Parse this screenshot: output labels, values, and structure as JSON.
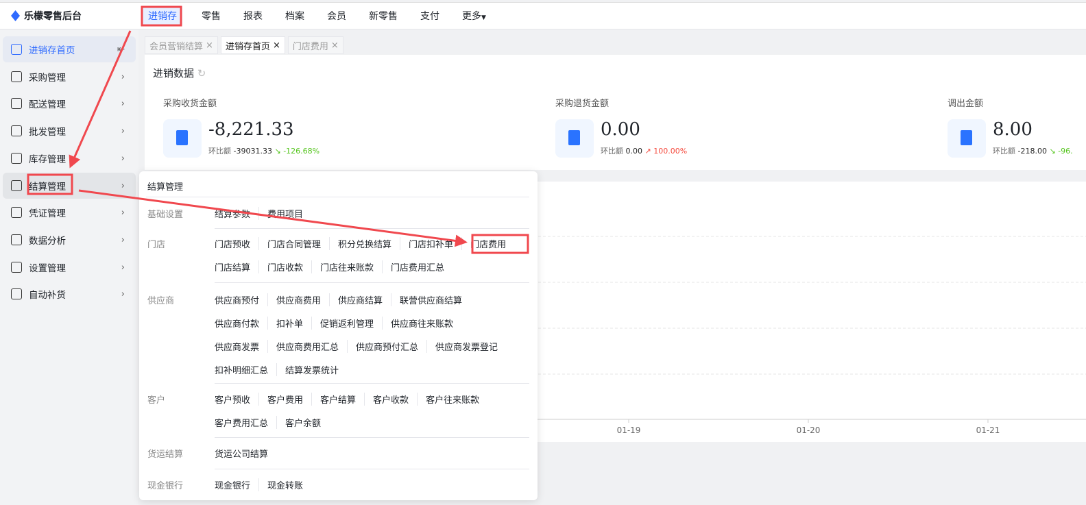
{
  "app": {
    "title": "乐檬零售后台"
  },
  "topnav": [
    "进销存",
    "零售",
    "报表",
    "档案",
    "会员",
    "新零售",
    "支付",
    "更多"
  ],
  "sidebar": [
    {
      "label": "进销存首页"
    },
    {
      "label": "采购管理"
    },
    {
      "label": "配送管理"
    },
    {
      "label": "批发管理"
    },
    {
      "label": "库存管理"
    },
    {
      "label": "结算管理"
    },
    {
      "label": "凭证管理"
    },
    {
      "label": "数据分析"
    },
    {
      "label": "设置管理"
    },
    {
      "label": "自动补货"
    }
  ],
  "tabs": [
    {
      "label": "会员营销结算"
    },
    {
      "label": "进销存首页"
    },
    {
      "label": "门店费用"
    }
  ],
  "card": {
    "title": "进销数据",
    "stats": [
      {
        "label": "采购收货金额",
        "value": "-8,221.33",
        "cmp_label": "环比额",
        "cmp_value": "-39031.33",
        "pct": "-126.68%",
        "trend": "down"
      },
      {
        "label": "采购退货金额",
        "value": "0.00",
        "cmp_label": "环比额",
        "cmp_value": "0.00",
        "pct": "100.00%",
        "trend": "up"
      },
      {
        "label": "调出金额",
        "value": "8.00",
        "cmp_label": "环比额",
        "cmp_value": "-218.00",
        "pct": "-96.",
        "trend": "down"
      }
    ]
  },
  "chart_data": {
    "type": "line",
    "categories": [
      "01-19",
      "01-20",
      "01-21"
    ],
    "series": [],
    "grid": true
  },
  "menu": {
    "title": "结算管理",
    "sections": [
      {
        "label": "基础设置",
        "rows": [
          [
            "结算参数",
            "费用项目"
          ]
        ]
      },
      {
        "label": "门店",
        "rows": [
          [
            "门店预收",
            "门店合同管理",
            "积分兑换结算",
            "门店扣补单",
            "门店费用"
          ],
          [
            "门店结算",
            "门店收款",
            "门店往来账款",
            "门店费用汇总"
          ]
        ]
      },
      {
        "label": "供应商",
        "rows": [
          [
            "供应商预付",
            "供应商费用",
            "供应商结算",
            "联营供应商结算"
          ],
          [
            "供应商付款",
            "扣补单",
            "促销返利管理",
            "供应商往来账款"
          ],
          [
            "供应商发票",
            "供应商费用汇总",
            "供应商预付汇总",
            "供应商发票登记"
          ],
          [
            "扣补明细汇总",
            "结算发票统计"
          ]
        ]
      },
      {
        "label": "客户",
        "rows": [
          [
            "客户预收",
            "客户费用",
            "客户结算",
            "客户收款",
            "客户往来账款"
          ],
          [
            "客户费用汇总",
            "客户余额"
          ]
        ]
      },
      {
        "label": "货运结算",
        "rows": [
          [
            "货运公司结算"
          ]
        ]
      },
      {
        "label": "现金银行",
        "rows": [
          [
            "现金银行",
            "现金转账"
          ]
        ]
      }
    ]
  },
  "colors": {
    "accent": "#2f6bff",
    "annotation": "#f0484e"
  }
}
